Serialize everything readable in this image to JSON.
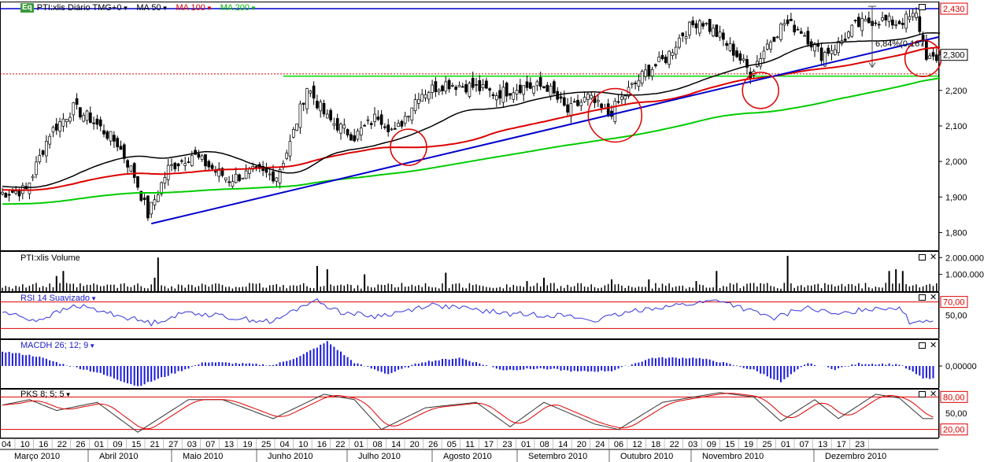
{
  "header": {
    "badge": "Eq",
    "symbol": "PTI:xlis Diário TMG+0",
    "ma50": "MA 50",
    "ma100": "MA 100",
    "ma200": "MA 200"
  },
  "annotation_pct": "6,84%(0,167)",
  "panels": {
    "volume_title": "PTI:xlis Volume",
    "rsi_title": "RSI 14 Suavizado",
    "macd_title": "MACDH 26; 12; 9",
    "pks_title": "PKS 8; 5; 5"
  },
  "colors": {
    "ma50": "#000000",
    "ma100": "#dd0000",
    "ma200": "#00cc00",
    "trend": "#0000cc",
    "support": "#00dd00",
    "resistance": "#0000cc",
    "circle": "#dd0000"
  },
  "chart_data": [
    {
      "type": "line",
      "title": "PTI:xlis Diário TMG+0",
      "ylim": [
        1.75,
        2.45
      ],
      "yticks": [
        "1,800",
        "1,900",
        "2,000",
        "2,100",
        "2,200",
        "2,300",
        "2,430"
      ],
      "x_day_labels": [
        "04",
        "10",
        "16",
        "22",
        "26",
        "01",
        "09",
        "15",
        "21",
        "27",
        "03",
        "07",
        "13",
        "19",
        "25",
        "04",
        "10",
        "16",
        "22",
        "01",
        "08",
        "14",
        "20",
        "26",
        "05",
        "11",
        "17",
        "23",
        "01",
        "08",
        "14",
        "20",
        "24",
        "06",
        "12",
        "18",
        "22",
        "03",
        "09",
        "15",
        "19",
        "25",
        "01",
        "07",
        "13",
        "17",
        "23"
      ],
      "x_month_labels": [
        "Março 2010",
        "Abril 2010",
        "Maio 2010",
        "Junho 2010",
        "Julho 2010",
        "Agosto 2010",
        "Setembro 2010",
        "Outubro 2010",
        "Novembro 2010",
        "Dezembro 2010"
      ],
      "price_anchors": [
        [
          0,
          1.91
        ],
        [
          8,
          1.92
        ],
        [
          15,
          2.08
        ],
        [
          22,
          2.15
        ],
        [
          27,
          2.12
        ],
        [
          35,
          2.05
        ],
        [
          40,
          1.96
        ],
        [
          44,
          1.85
        ],
        [
          50,
          1.98
        ],
        [
          57,
          2.02
        ],
        [
          63,
          1.98
        ],
        [
          68,
          1.95
        ],
        [
          75,
          1.97
        ],
        [
          82,
          1.96
        ],
        [
          86,
          2.05
        ],
        [
          91,
          2.21
        ],
        [
          97,
          2.12
        ],
        [
          105,
          2.07
        ],
        [
          112,
          2.13
        ],
        [
          117,
          2.08
        ],
        [
          124,
          2.19
        ],
        [
          132,
          2.22
        ],
        [
          140,
          2.21
        ],
        [
          147,
          2.19
        ],
        [
          154,
          2.21
        ],
        [
          162,
          2.21
        ],
        [
          168,
          2.14
        ],
        [
          174,
          2.18
        ],
        [
          180,
          2.13
        ],
        [
          186,
          2.2
        ],
        [
          191,
          2.25
        ],
        [
          197,
          2.29
        ],
        [
          202,
          2.36
        ],
        [
          207,
          2.4
        ],
        [
          213,
          2.35
        ],
        [
          218,
          2.3
        ],
        [
          222,
          2.25
        ],
        [
          227,
          2.33
        ],
        [
          232,
          2.39
        ],
        [
          237,
          2.37
        ],
        [
          243,
          2.3
        ],
        [
          248,
          2.33
        ],
        [
          253,
          2.38
        ],
        [
          259,
          2.4
        ],
        [
          265,
          2.39
        ],
        [
          271,
          2.41
        ],
        [
          274,
          2.3
        ],
        [
          276,
          2.28
        ]
      ],
      "ma_periods": [
        50,
        100,
        200
      ],
      "ma_start_values": [
        1.93,
        1.92,
        1.88
      ],
      "trendline": [
        [
          44,
          1.825
        ],
        [
          276,
          2.275
        ],
        [
          322,
          2.35
        ]
      ],
      "support": 2.24,
      "resistance": 2.43,
      "target_line": 2.335,
      "circles_at": [
        [
          120,
          2.04
        ],
        [
          181,
          2.13
        ],
        [
          224,
          2.2
        ],
        [
          272,
          2.29
        ]
      ],
      "last_price_label": "2,430",
      "target_label": "2,300"
    },
    {
      "type": "bar",
      "title": "PTI:xlis Volume",
      "yticks": [
        "2.000.000",
        "1.000.000"
      ],
      "ylim": [
        0,
        2200000
      ],
      "spikes": [
        [
          16,
          900000
        ],
        [
          18,
          1200000
        ],
        [
          46,
          2000000
        ],
        [
          45,
          800000
        ],
        [
          93,
          1500000
        ],
        [
          96,
          1300000
        ],
        [
          107,
          1000000
        ],
        [
          131,
          1100000
        ],
        [
          155,
          600000
        ],
        [
          160,
          800000
        ],
        [
          180,
          700000
        ],
        [
          191,
          700000
        ],
        [
          205,
          600000
        ],
        [
          211,
          1200000
        ],
        [
          232,
          2100000
        ],
        [
          262,
          1200000
        ],
        [
          264,
          1300000
        ],
        [
          266,
          1200000
        ]
      ]
    },
    {
      "type": "line",
      "title": "RSI 14 Suavizado",
      "ylim": [
        15,
        85
      ],
      "levels": [
        70,
        30
      ],
      "yticks": [
        "70,00",
        "50,00"
      ],
      "anchors": [
        [
          0,
          55
        ],
        [
          10,
          42
        ],
        [
          22,
          65
        ],
        [
          30,
          55
        ],
        [
          44,
          38
        ],
        [
          55,
          55
        ],
        [
          70,
          45
        ],
        [
          80,
          40
        ],
        [
          92,
          73
        ],
        [
          100,
          55
        ],
        [
          110,
          48
        ],
        [
          118,
          55
        ],
        [
          126,
          66
        ],
        [
          140,
          58
        ],
        [
          150,
          52
        ],
        [
          165,
          50
        ],
        [
          175,
          42
        ],
        [
          190,
          60
        ],
        [
          205,
          68
        ],
        [
          212,
          73
        ],
        [
          220,
          58
        ],
        [
          228,
          45
        ],
        [
          237,
          62
        ],
        [
          247,
          50
        ],
        [
          255,
          60
        ],
        [
          265,
          62
        ],
        [
          268,
          40
        ],
        [
          272,
          42
        ]
      ]
    },
    {
      "type": "bar",
      "title": "MACDH 26; 12; 9",
      "ylim": [
        -0.03,
        0.03
      ],
      "yticks": [
        "0,00000"
      ],
      "anchors": [
        [
          0,
          0.018
        ],
        [
          10,
          0.012
        ],
        [
          18,
          0.002
        ],
        [
          28,
          -0.008
        ],
        [
          40,
          -0.025
        ],
        [
          50,
          -0.01
        ],
        [
          60,
          0.005
        ],
        [
          70,
          0.003
        ],
        [
          80,
          0.001
        ],
        [
          88,
          0.012
        ],
        [
          96,
          0.03
        ],
        [
          104,
          0.004
        ],
        [
          114,
          -0.01
        ],
        [
          124,
          0.005
        ],
        [
          135,
          0.01
        ],
        [
          148,
          -0.005
        ],
        [
          160,
          -0.003
        ],
        [
          170,
          -0.007
        ],
        [
          180,
          -0.006
        ],
        [
          192,
          0.01
        ],
        [
          205,
          0.01
        ],
        [
          212,
          0.005
        ],
        [
          222,
          -0.005
        ],
        [
          230,
          -0.02
        ],
        [
          238,
          0.004
        ],
        [
          246,
          -0.004
        ],
        [
          253,
          0.003
        ],
        [
          265,
          0.002
        ],
        [
          272,
          -0.015
        ]
      ]
    },
    {
      "type": "line",
      "title": "PKS 8; 5; 5",
      "ylim": [
        5,
        95
      ],
      "levels": [
        80,
        20
      ],
      "yticks": [
        "80,00",
        "50,00",
        "20,00"
      ],
      "anchors": [
        [
          0,
          65
        ],
        [
          8,
          75
        ],
        [
          16,
          55
        ],
        [
          28,
          70
        ],
        [
          40,
          15
        ],
        [
          55,
          75
        ],
        [
          65,
          75
        ],
        [
          80,
          40
        ],
        [
          95,
          85
        ],
        [
          104,
          75
        ],
        [
          112,
          20
        ],
        [
          125,
          60
        ],
        [
          140,
          70
        ],
        [
          150,
          25
        ],
        [
          160,
          70
        ],
        [
          175,
          30
        ],
        [
          182,
          20
        ],
        [
          195,
          70
        ],
        [
          212,
          88
        ],
        [
          222,
          80
        ],
        [
          230,
          35
        ],
        [
          240,
          75
        ],
        [
          247,
          40
        ],
        [
          258,
          85
        ],
        [
          265,
          78
        ],
        [
          272,
          40
        ]
      ]
    }
  ]
}
